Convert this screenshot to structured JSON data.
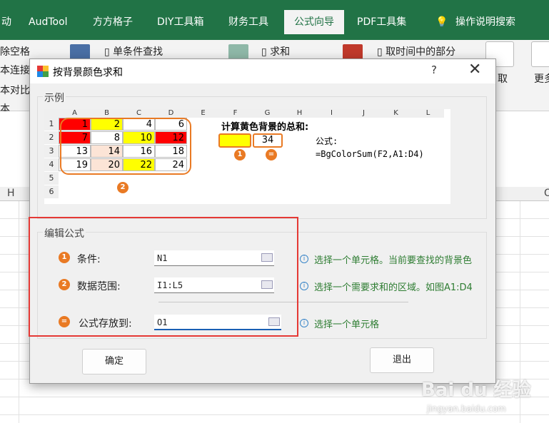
{
  "ribbon": {
    "tabs": [
      "动",
      "AudTool",
      "方方格子",
      "DIY工具箱",
      "财务工具",
      "公式向导",
      "PDF工具集",
      "操作说明搜索"
    ],
    "active_tab": "公式向导",
    "buttons": {
      "remove_space": "除空格",
      "text_connect": "本连接",
      "text_compare": "本对比",
      "single_condition": "单条件查找",
      "sum": "求和",
      "take_time_part": "取时间中的部分",
      "take": "取",
      "more": "更多",
      "misc": "本"
    }
  },
  "sheet": {
    "col_h": "H",
    "col_o": "O"
  },
  "dialog": {
    "title": "按背景颜色求和",
    "help": "?",
    "close": "✕",
    "example_group": "示例",
    "example": {
      "cols": [
        "A",
        "B",
        "C",
        "D",
        "E",
        "F",
        "G",
        "H",
        "I",
        "J",
        "K",
        "L"
      ],
      "rows": [
        "1",
        "2",
        "3",
        "4",
        "5",
        "6"
      ],
      "grid": [
        [
          {
            "v": "1",
            "c": "#ff0000"
          },
          {
            "v": "2",
            "c": "#ffff00"
          },
          {
            "v": "4",
            "c": "#ffffff"
          },
          {
            "v": "6",
            "c": "#ffffff"
          }
        ],
        [
          {
            "v": "7",
            "c": "#ff0000"
          },
          {
            "v": "8",
            "c": "#ffffff"
          },
          {
            "v": "10",
            "c": "#ffff00"
          },
          {
            "v": "12",
            "c": "#ff0000"
          }
        ],
        [
          {
            "v": "13",
            "c": "#ffffff"
          },
          {
            "v": "14",
            "c": "#fce4d6"
          },
          {
            "v": "16",
            "c": "#ffffff"
          },
          {
            "v": "18",
            "c": "#ffffff"
          }
        ],
        [
          {
            "v": "19",
            "c": "#ffffff"
          },
          {
            "v": "20",
            "c": "#fce4d6"
          },
          {
            "v": "22",
            "c": "#ffff00"
          },
          {
            "v": "24",
            "c": "#ffffff"
          }
        ]
      ],
      "heading": "计算黄色背景的总和:",
      "result": "34",
      "formula_label": "公式:",
      "formula": "=BgColorSum(F2,A1:D4)",
      "marker1": "1",
      "marker2": "2",
      "marker_eq": "="
    },
    "edit_group": "编辑公式",
    "fields": [
      {
        "label": "条件:",
        "value": "N1",
        "hint": "选择一个单元格。当前要查找的背景色"
      },
      {
        "label": "数据范围:",
        "value": "I1:L5",
        "hint": "选择一个需要求和的区域。如图A1:D4"
      },
      {
        "label": "公式存放到:",
        "value": "O1",
        "hint": "选择一个单元格"
      }
    ],
    "ok": "确定",
    "exit": "退出"
  },
  "watermark": {
    "brand": "Bai du 经验",
    "url": "jingyan.baidu.com"
  },
  "colors": {
    "excel_green": "#217346",
    "accent_orange": "#e97a24",
    "highlight_red": "#e53935"
  }
}
